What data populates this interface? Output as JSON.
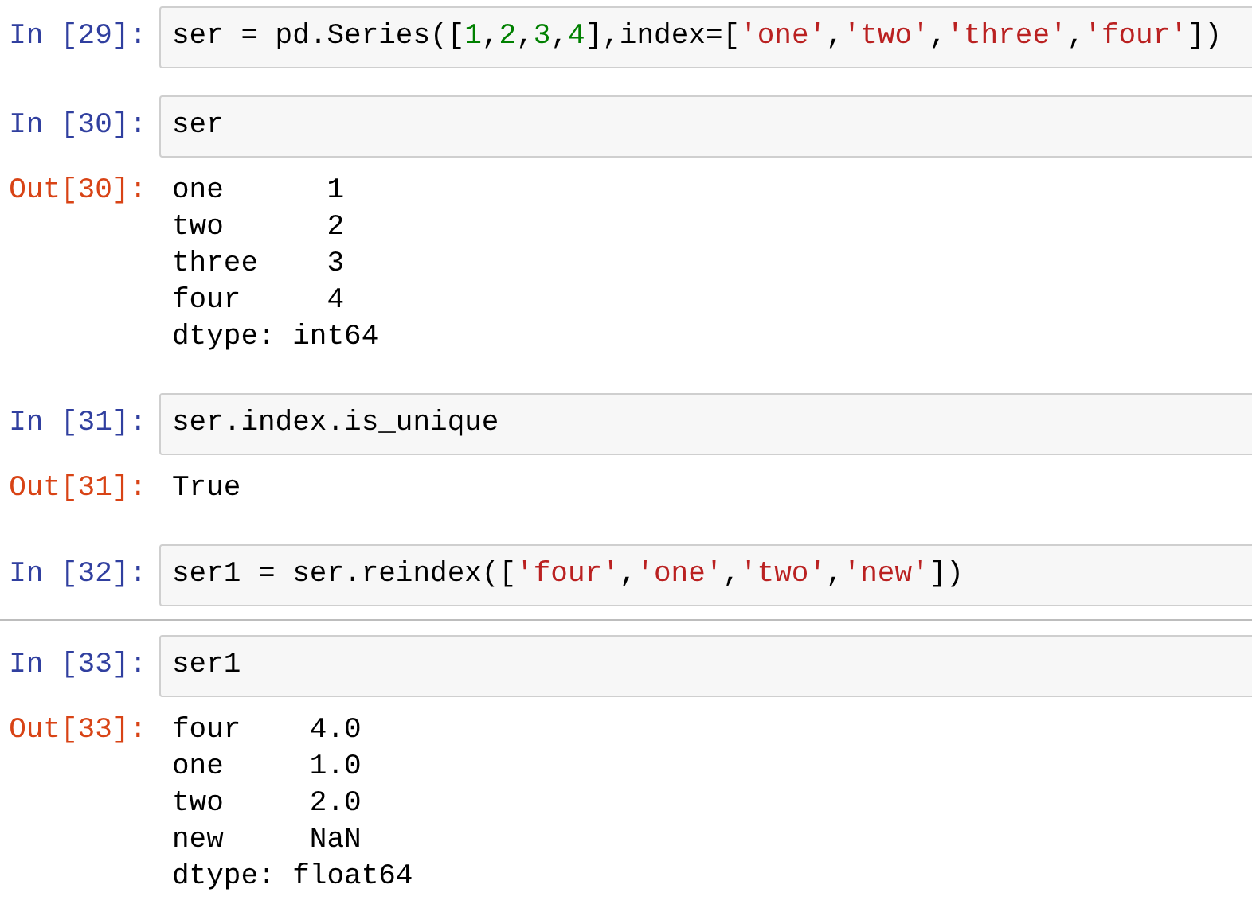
{
  "cells": [
    {
      "prompt": "In [29]:",
      "selected": false,
      "code": [
        {
          "kind": "plain",
          "text": "ser = pd.Series(["
        },
        {
          "kind": "number",
          "text": "1"
        },
        {
          "kind": "plain",
          "text": ","
        },
        {
          "kind": "number",
          "text": "2"
        },
        {
          "kind": "plain",
          "text": ","
        },
        {
          "kind": "number",
          "text": "3"
        },
        {
          "kind": "plain",
          "text": ","
        },
        {
          "kind": "number",
          "text": "4"
        },
        {
          "kind": "plain",
          "text": "],index=["
        },
        {
          "kind": "string",
          "text": "'one'"
        },
        {
          "kind": "plain",
          "text": ","
        },
        {
          "kind": "string",
          "text": "'two'"
        },
        {
          "kind": "plain",
          "text": ","
        },
        {
          "kind": "string",
          "text": "'three'"
        },
        {
          "kind": "plain",
          "text": ","
        },
        {
          "kind": "string",
          "text": "'four'"
        },
        {
          "kind": "plain",
          "text": "])"
        }
      ]
    },
    {
      "prompt": "In [30]:",
      "selected": false,
      "code": [
        {
          "kind": "plain",
          "text": "ser"
        }
      ],
      "output": {
        "prompt": "Out[30]:",
        "lines": [
          "one      1",
          "two      2",
          "three    3",
          "four     4",
          "dtype: int64"
        ]
      }
    },
    {
      "prompt": "In [31]:",
      "selected": false,
      "code": [
        {
          "kind": "plain",
          "text": "ser.index.is_unique"
        }
      ],
      "output": {
        "prompt": "Out[31]:",
        "lines": [
          "True"
        ]
      }
    },
    {
      "prompt": "In [32]:",
      "selected": true,
      "code": [
        {
          "kind": "plain",
          "text": "ser1 = ser.reindex(["
        },
        {
          "kind": "string",
          "text": "'four'"
        },
        {
          "kind": "plain",
          "text": ","
        },
        {
          "kind": "string",
          "text": "'one'"
        },
        {
          "kind": "plain",
          "text": ","
        },
        {
          "kind": "string",
          "text": "'two'"
        },
        {
          "kind": "plain",
          "text": ","
        },
        {
          "kind": "string",
          "text": "'new'"
        },
        {
          "kind": "plain",
          "text": "])"
        }
      ]
    },
    {
      "prompt": "In [33]:",
      "selected": false,
      "code": [
        {
          "kind": "plain",
          "text": "ser1"
        }
      ],
      "output": {
        "prompt": "Out[33]:",
        "lines": [
          "four    4.0",
          "one     1.0",
          "two     2.0",
          "new     NaN",
          "dtype: float64"
        ]
      }
    }
  ]
}
